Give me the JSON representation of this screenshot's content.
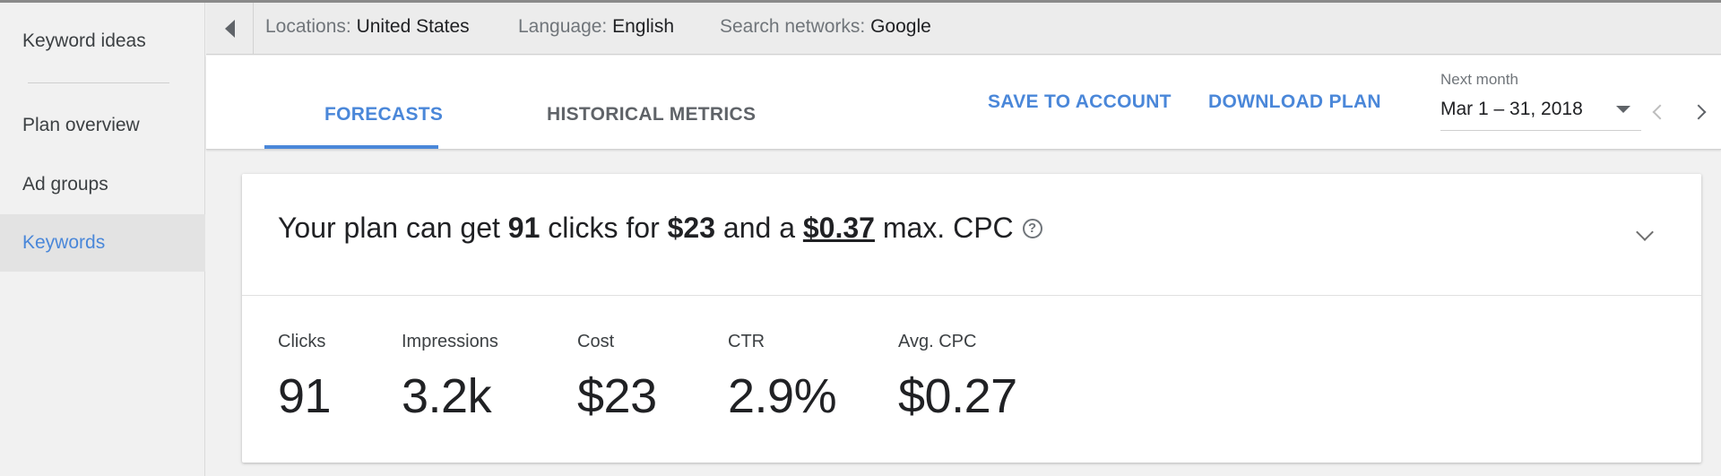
{
  "sidebar": {
    "items": [
      {
        "label": "Keyword ideas",
        "active": false
      },
      {
        "label": "Plan overview",
        "active": false
      },
      {
        "label": "Ad groups",
        "active": false
      },
      {
        "label": "Keywords",
        "active": true
      }
    ]
  },
  "filters": {
    "locations": {
      "key": "Locations:",
      "value": "United States"
    },
    "language": {
      "key": "Language:",
      "value": "English"
    },
    "networks": {
      "key": "Search networks:",
      "value": "Google"
    }
  },
  "tabs": [
    {
      "label": "FORECASTS",
      "active": true
    },
    {
      "label": "HISTORICAL METRICS",
      "active": false
    }
  ],
  "actions": {
    "save": "SAVE TO ACCOUNT",
    "download": "DOWNLOAD PLAN"
  },
  "date_range": {
    "label": "Next month",
    "value": "Mar 1 – 31, 2018"
  },
  "summary": {
    "prefix": "Your plan can get",
    "clicks": "91",
    "mid1": "clicks for",
    "cost": "$23",
    "mid2": "and a",
    "max_cpc": "$0.37",
    "suffix": "max. CPC",
    "help_glyph": "?"
  },
  "metrics": [
    {
      "label": "Clicks",
      "value": "91"
    },
    {
      "label": "Impressions",
      "value": "3.2k"
    },
    {
      "label": "Cost",
      "value": "$23"
    },
    {
      "label": "CTR",
      "value": "2.9%"
    },
    {
      "label": "Avg. CPC",
      "value": "$0.27"
    }
  ],
  "colors": {
    "accent": "#4a87d9",
    "sidebar_active_bg": "#e3e3e3",
    "background": "#f1f1f1"
  },
  "icons": {
    "collapse": "caret-left-icon",
    "dropdown": "caret-down-icon",
    "prev": "chevron-left-icon",
    "next": "chevron-right-icon",
    "help": "help-circle-icon",
    "expand": "chevron-down-icon"
  }
}
